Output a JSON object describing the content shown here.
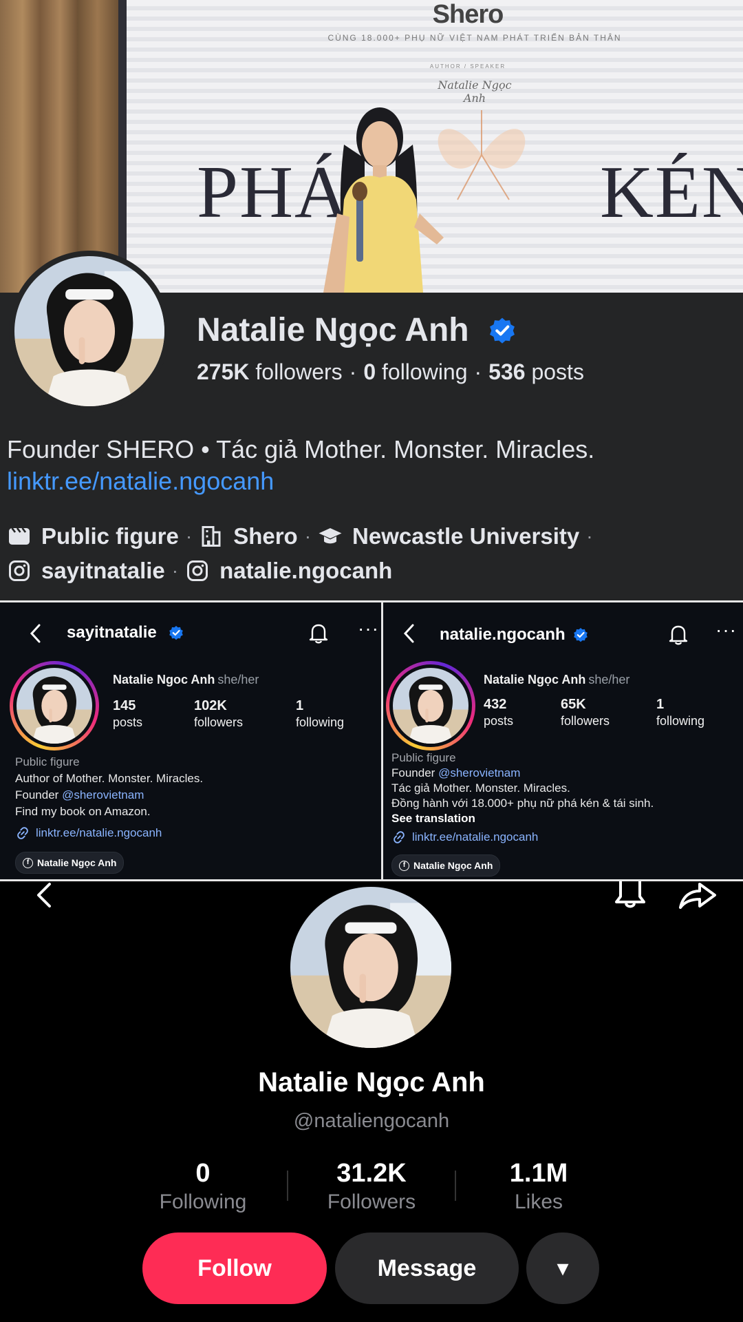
{
  "facebook": {
    "cover": {
      "brand": "Shero",
      "tagline": "CÙNG 18.000+ PHỤ NỮ VIỆT NAM PHÁT TRIỂN BẢN THÂN",
      "role": "AUTHOR / SPEAKER",
      "signature": "Natalie Ngọc Anh",
      "word_left": "PHÁ",
      "word_right": "KÉN"
    },
    "name": "Natalie Ngọc Anh",
    "verified_icon": "verified-badge-icon",
    "stats": {
      "followers_value": "275K",
      "followers_label": "followers",
      "following_value": "0",
      "following_label": "following",
      "posts_value": "536",
      "posts_label": "posts",
      "separator": "·"
    },
    "bio": "Founder SHERO • Tác giả Mother. Monster. Miracles.",
    "link": "linktr.ee/natalie.ngocanh",
    "meta": {
      "category": "Public figure",
      "workplace": "Shero",
      "education": "Newcastle University",
      "instagram_1": "sayitnatalie",
      "instagram_2": "natalie.ngocanh",
      "separator": "·"
    }
  },
  "instagram_left": {
    "handle": "sayitnatalie",
    "name": "Natalie Ngoc Anh",
    "pronouns": "she/her",
    "posts_value": "145",
    "posts_label": "posts",
    "followers_value": "102K",
    "followers_label": "followers",
    "following_value": "1",
    "following_label": "following",
    "category": "Public figure",
    "bio_line_1": "Author of Mother. Monster. Miracles.",
    "bio_line_2_prefix": "Founder",
    "bio_line_2_mention": "@sherovietnam",
    "bio_line_3": "Find my book on Amazon.",
    "link": "linktr.ee/natalie.ngocanh",
    "fb_chip": "Natalie Ngọc Anh",
    "more_glyph": "···"
  },
  "instagram_right": {
    "handle": "natalie.ngocanh",
    "name": "Natalie Ngọc Anh",
    "pronouns": "she/her",
    "posts_value": "432",
    "posts_label": "posts",
    "followers_value": "65K",
    "followers_label": "followers",
    "following_value": "1",
    "following_label": "following",
    "category": "Public figure",
    "bio_line_1_prefix": "Founder",
    "bio_line_1_mention": "@sherovietnam",
    "bio_line_2": "Tác giả Mother. Monster. Miracles.",
    "bio_line_3": "Đồng hành với 18.000+ phụ nữ phá kén & tái sinh.",
    "see_translation": "See translation",
    "link": "linktr.ee/natalie.ngocanh",
    "fb_chip": "Natalie Ngọc Anh",
    "more_glyph": "···"
  },
  "tiktok": {
    "name": "Natalie Ngọc Anh",
    "handle": "@nataliengocanh",
    "following_value": "0",
    "following_label": "Following",
    "followers_value": "31.2K",
    "followers_label": "Followers",
    "likes_value": "1.1M",
    "likes_label": "Likes",
    "follow_label": "Follow",
    "message_label": "Message",
    "more_glyph": "▾"
  },
  "colors": {
    "facebook_bg": "#242526",
    "facebook_link": "#4599ff",
    "verified_blue": "#1877f2",
    "instagram_bg": "#0b0e14",
    "instagram_link": "#8ab4ff",
    "tiktok_follow": "#fe2c55",
    "tiktok_secondary_button": "#2a2a2c"
  }
}
